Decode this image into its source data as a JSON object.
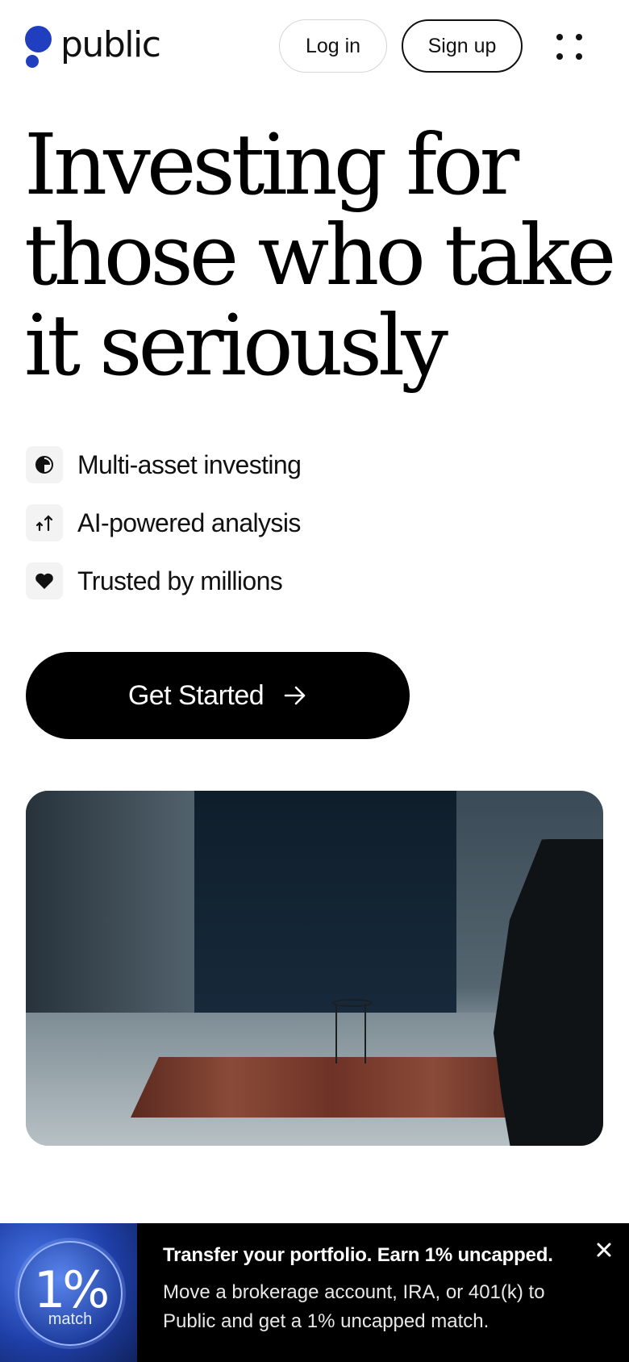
{
  "header": {
    "logo_text": "public",
    "login_label": "Log in",
    "signup_label": "Sign up",
    "menu_icon": "dots-grid-icon",
    "brand_color": "#1f3fbf"
  },
  "hero": {
    "title": "Investing for those who take it seriously"
  },
  "features": [
    {
      "icon": "pie-chart-icon",
      "label": "Multi-asset investing"
    },
    {
      "icon": "arrows-up-icon",
      "label": "AI-powered analysis"
    },
    {
      "icon": "heart-icon",
      "label": "Trusted by millions"
    }
  ],
  "cta": {
    "label": "Get Started",
    "icon": "arrow-right-icon"
  },
  "media": {
    "icon": "video-still"
  },
  "promo": {
    "badge_value": "1%",
    "badge_caption": "match",
    "title": "Transfer your portfolio. Earn 1% uncapped.",
    "body": "Move a brokerage account, IRA, or 401(k) to Public and get a 1% uncapped match.",
    "close_icon": "close-icon"
  }
}
